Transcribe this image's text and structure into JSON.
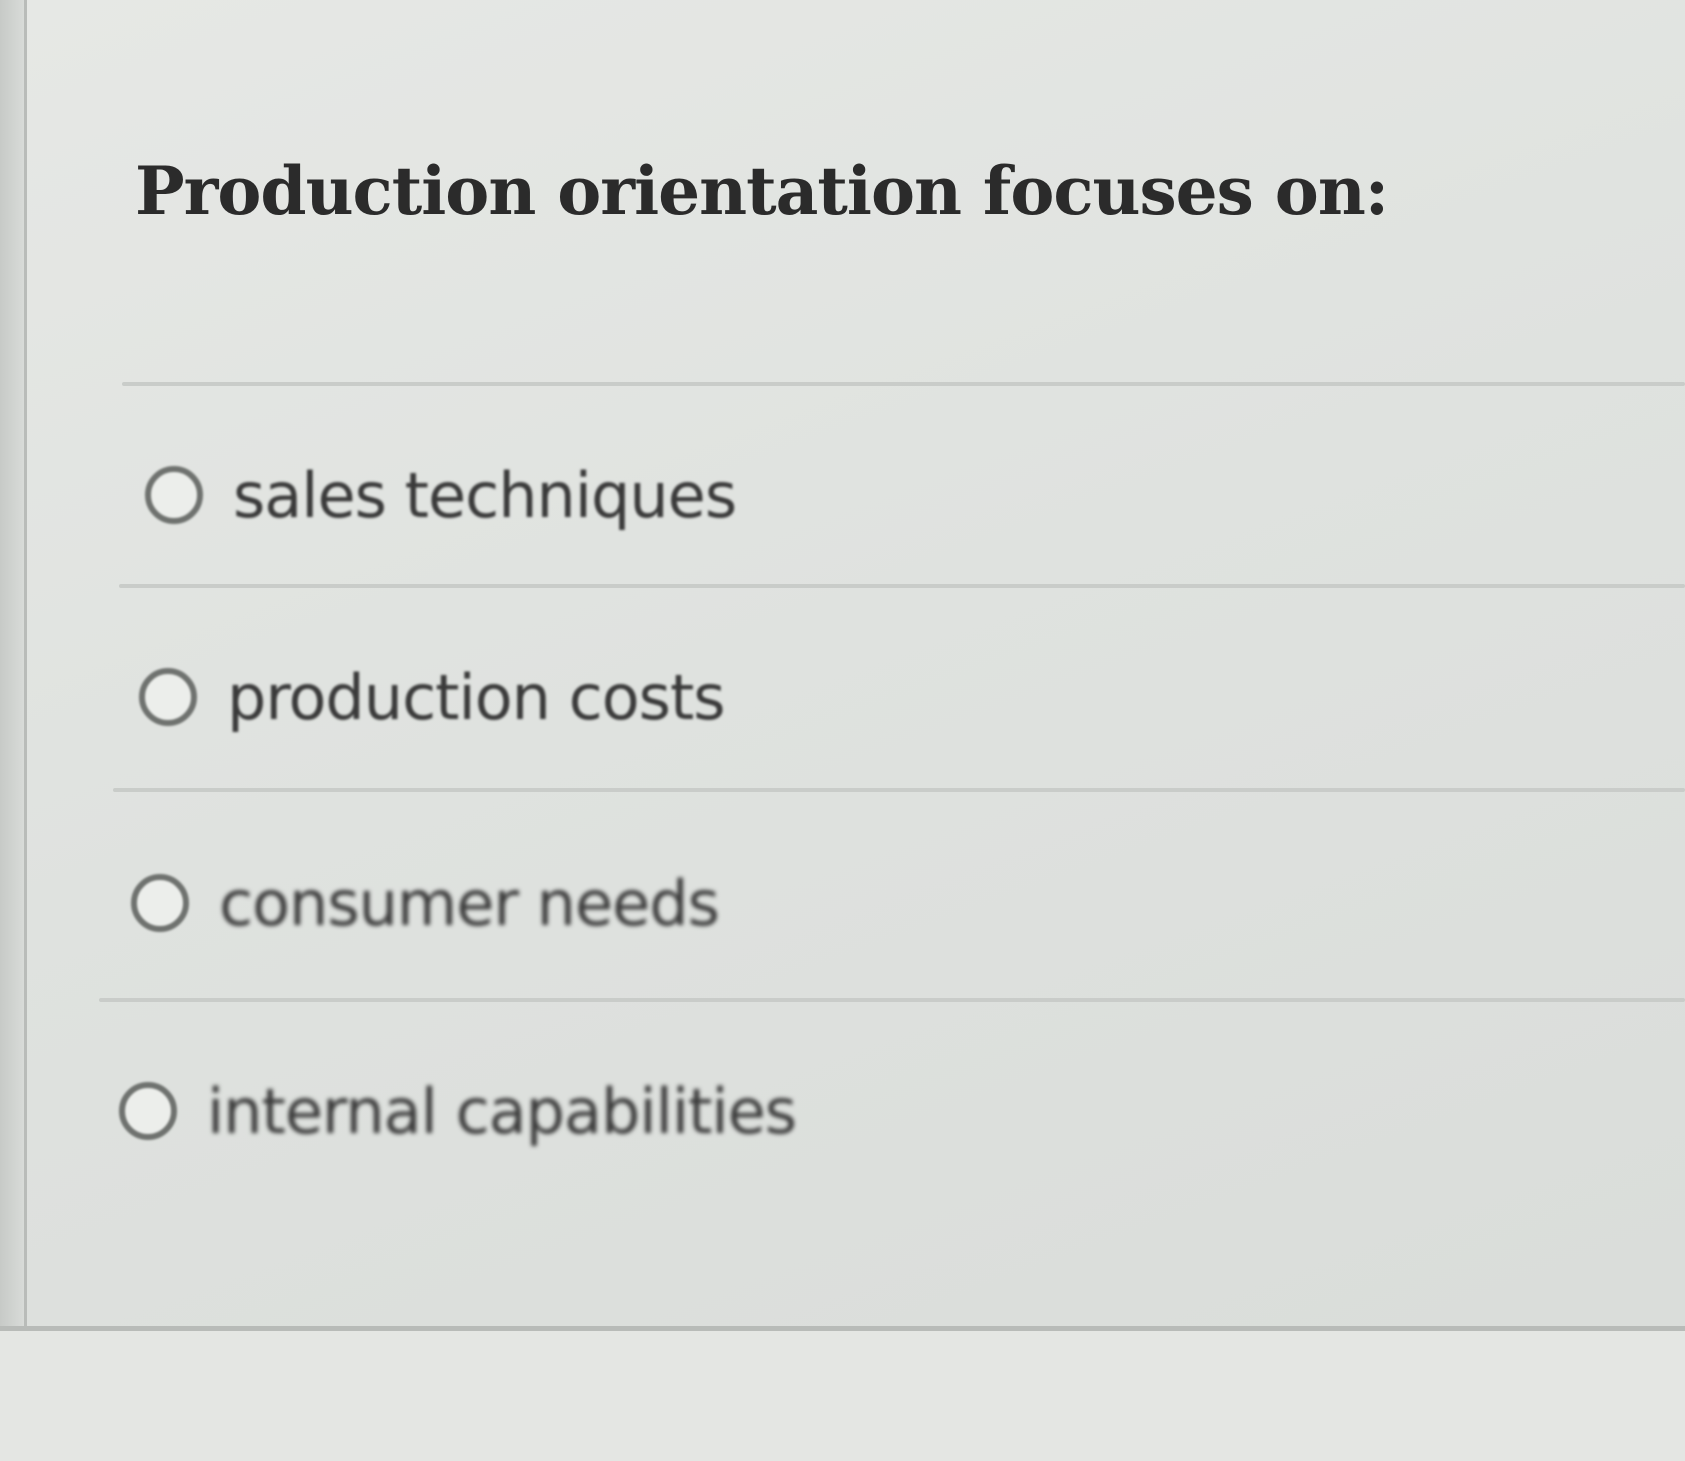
{
  "question": {
    "text": "Production orientation focuses on:"
  },
  "options": [
    {
      "label": "sales techniques",
      "selected": false
    },
    {
      "label": "production costs",
      "selected": false
    },
    {
      "label": "consumer needs",
      "selected": false
    },
    {
      "label": "internal capabilities",
      "selected": false
    }
  ],
  "colors": {
    "background": "#e1e4e1",
    "text": "#2b2b2b",
    "radio_border": "#6f726f",
    "divider": "#c9ccc9"
  },
  "icons": {
    "radio": "radio-unchecked-icon"
  }
}
